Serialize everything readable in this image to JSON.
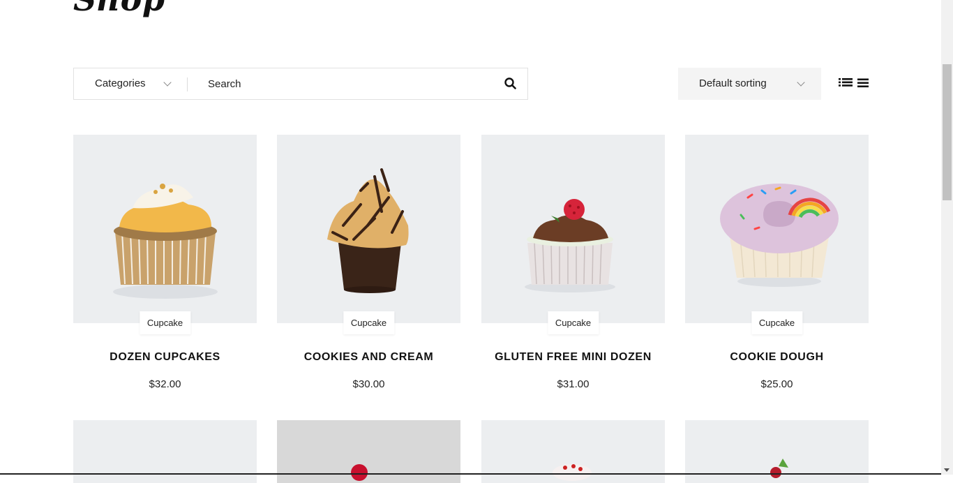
{
  "page": {
    "title": "Shop"
  },
  "filters": {
    "categories_label": "Categories",
    "search_placeholder": "Search",
    "sort_label": "Default sorting"
  },
  "products": [
    {
      "category": "Cupcake",
      "title": "DOZEN CUPCAKES",
      "price": "$32.00"
    },
    {
      "category": "Cupcake",
      "title": "COOKIES AND CREAM",
      "price": "$30.00"
    },
    {
      "category": "Cupcake",
      "title": "GLUTEN FREE MINI DOZEN",
      "price": "$31.00"
    },
    {
      "category": "Cupcake",
      "title": "COOKIE DOUGH",
      "price": "$25.00"
    }
  ],
  "colors": {
    "thumb_bg": "#eceef0",
    "sort_bg": "#f4f4f4",
    "text": "#222222"
  },
  "icons": [
    "search-icon",
    "chevron-down-icon",
    "list-view-icon",
    "grid-view-icon"
  ]
}
